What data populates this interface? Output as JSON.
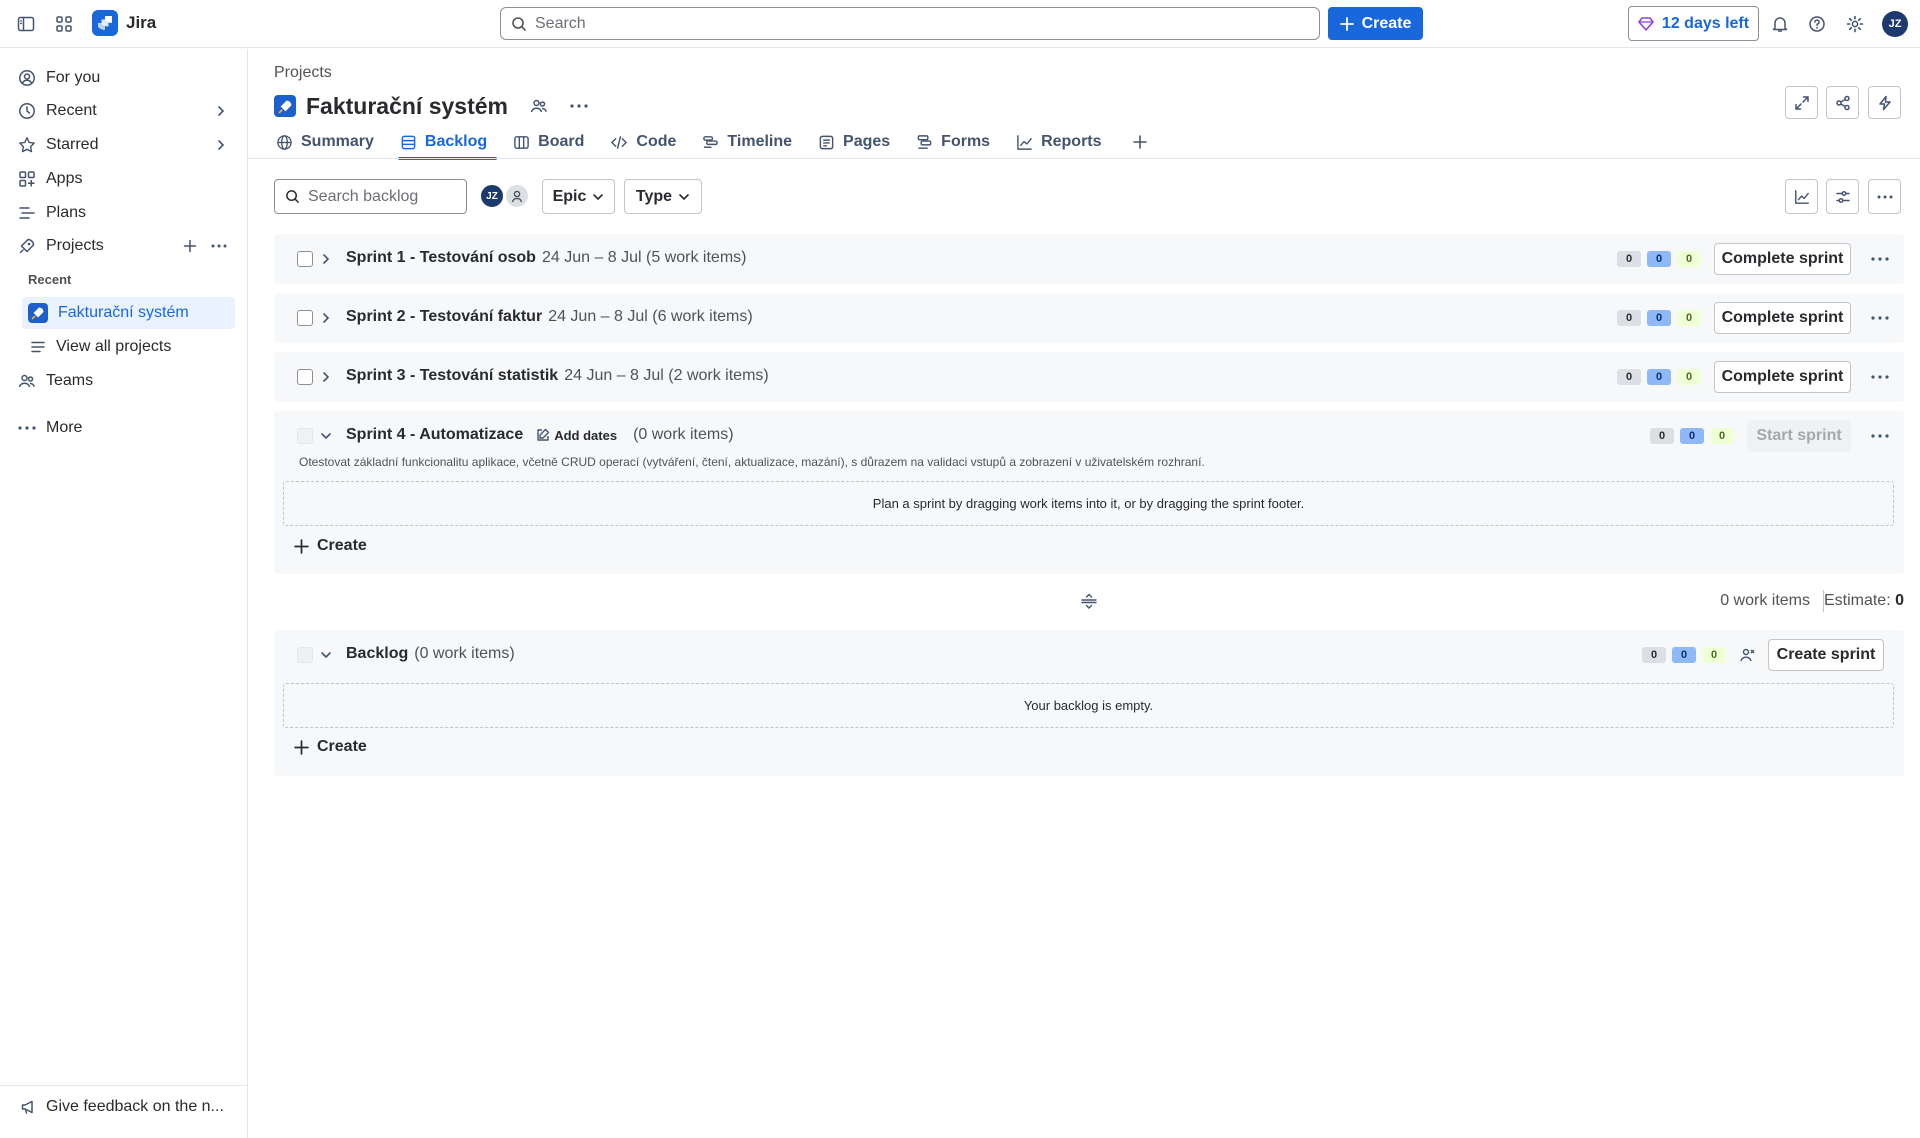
{
  "topbar": {
    "app_name": "Jira",
    "search_placeholder": "Search",
    "create_label": "Create",
    "trial_label": "12 days left",
    "avatar_initials": "JZ"
  },
  "sidebar": {
    "items": [
      {
        "label": "For you",
        "icon": "user-circle-icon"
      },
      {
        "label": "Recent",
        "icon": "clock-icon"
      },
      {
        "label": "Starred",
        "icon": "star-icon"
      },
      {
        "label": "Apps",
        "icon": "apps-icon"
      },
      {
        "label": "Plans",
        "icon": "plans-icon"
      },
      {
        "label": "Projects",
        "icon": "rocket-icon"
      }
    ],
    "recent_heading": "Recent",
    "active_project": "Fakturační systém",
    "view_all": "View all projects",
    "teams": "Teams",
    "more": "More",
    "feedback": "Give feedback on the n..."
  },
  "header": {
    "breadcrumb": "Projects",
    "project_title": "Fakturační systém",
    "tabs": [
      {
        "label": "Summary",
        "icon": "globe-icon"
      },
      {
        "label": "Backlog",
        "icon": "backlog-icon",
        "active": true
      },
      {
        "label": "Board",
        "icon": "board-icon"
      },
      {
        "label": "Code",
        "icon": "code-icon"
      },
      {
        "label": "Timeline",
        "icon": "timeline-icon"
      },
      {
        "label": "Pages",
        "icon": "pages-icon"
      },
      {
        "label": "Forms",
        "icon": "forms-icon"
      },
      {
        "label": "Reports",
        "icon": "reports-icon"
      }
    ]
  },
  "filters": {
    "search_placeholder": "Search backlog",
    "avatar_initials": "JZ",
    "epic_label": "Epic",
    "type_label": "Type"
  },
  "sprints": [
    {
      "name": "Sprint 1 - Testování osob",
      "meta": "24 Jun – 8 Jul (5 work items)",
      "counts": [
        "0",
        "0",
        "0"
      ],
      "action": "Complete sprint"
    },
    {
      "name": "Sprint 2 - Testování faktur",
      "meta": "24 Jun – 8 Jul (6 work items)",
      "counts": [
        "0",
        "0",
        "0"
      ],
      "action": "Complete sprint"
    },
    {
      "name": "Sprint 3 - Testování statistik",
      "meta": "24 Jun – 8 Jul (2 work items)",
      "counts": [
        "0",
        "0",
        "0"
      ],
      "action": "Complete sprint"
    },
    {
      "name": "Sprint 4 - Automatizace",
      "add_dates": "Add dates",
      "meta": "(0 work items)",
      "counts": [
        "0",
        "0",
        "0"
      ],
      "action": "Start sprint",
      "description": "Otestovat základní funkcionalitu aplikace, včetně CRUD operací (vytváření, čtení, aktualizace, mazání), s důrazem na validaci vstupů a zobrazení v uživatelském rozhraní.",
      "dropzone": "Plan a sprint by dragging work items into it, or by dragging the sprint footer.",
      "create": "Create"
    }
  ],
  "summary": {
    "work_items": "0 work items",
    "estimate_label": "Estimate:",
    "estimate_value": "0"
  },
  "backlog": {
    "name": "Backlog",
    "meta": "(0 work items)",
    "counts": [
      "0",
      "0",
      "0"
    ],
    "action": "Create sprint",
    "empty": "Your backlog is empty.",
    "create": "Create"
  },
  "colors": {
    "accent": "#1868db",
    "trial": "#8f44d6"
  }
}
